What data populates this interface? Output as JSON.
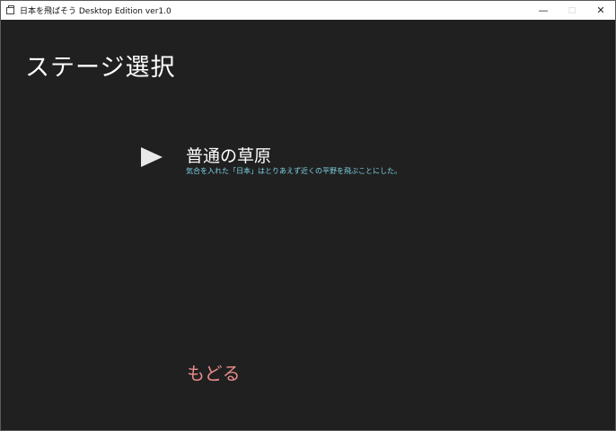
{
  "window": {
    "title": "日本を飛ばそう Desktop Edition ver1.0",
    "icon": "window-app-icon",
    "controls": {
      "minimize": "—",
      "maximize": "□",
      "close": "✕"
    }
  },
  "page": {
    "title": "ステージ選択"
  },
  "stages": [
    {
      "name": "普通の草原",
      "description": "気合を入れた「日本」はとりあえず近くの平野を飛ぶことにした。",
      "selected": true
    }
  ],
  "cursor_icon": "triangle-right-icon",
  "back_label": "もどる",
  "colors": {
    "background": "#202020",
    "title_text": "#ffffff",
    "description_text": "#7fd4e6",
    "back_text": "#e88a8a"
  }
}
